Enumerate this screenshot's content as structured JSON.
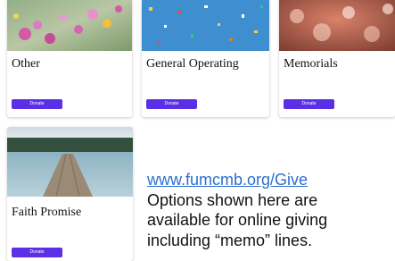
{
  "cards": [
    {
      "label": "Other",
      "button": "Donate",
      "image": "pink-flowers-photo"
    },
    {
      "label": "General Operating",
      "button": "Donate",
      "image": "confetti-photo"
    },
    {
      "label": "Memorials",
      "button": "Donate",
      "image": "bokeh-hearts-photo"
    },
    {
      "label": "Faith Promise",
      "button": "Donate",
      "image": "lake-dock-photo"
    }
  ],
  "info": {
    "link": "www.fumcmb.org/Give",
    "lines": [
      "Options shown here are",
      "available for online giving",
      "including “memo” lines."
    ]
  },
  "colors": {
    "button": "#5b2fe6",
    "link": "#2d6fd1"
  }
}
